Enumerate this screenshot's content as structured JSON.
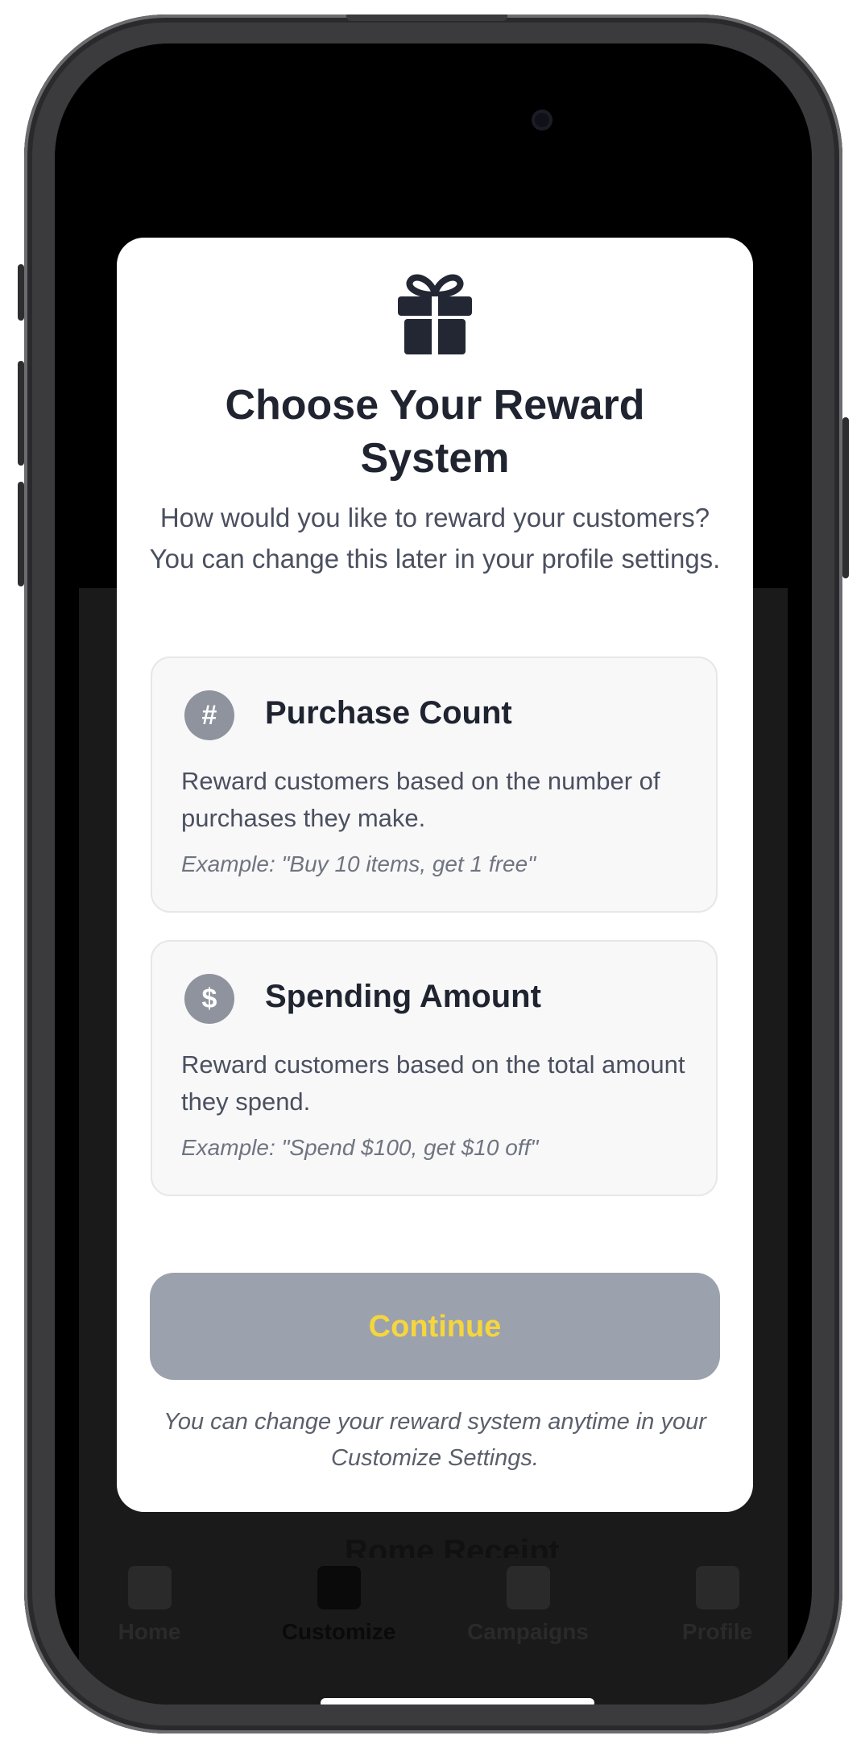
{
  "modal": {
    "icon": "gift-icon",
    "title": "Choose Your Reward System",
    "subtitle": "How would you like to reward your customers? You can change this later in your profile settings.",
    "options": [
      {
        "icon": "hash-icon",
        "glyph": "#",
        "title": "Purchase Count",
        "description": "Reward customers based on the number of purchases they make.",
        "example": "Example: \"Buy 10 items, get 1 free\""
      },
      {
        "icon": "dollar-icon",
        "glyph": "$",
        "title": "Spending Amount",
        "description": "Reward customers based on the total amount they spend.",
        "example": "Example: \"Spend $100, get $10 off\""
      }
    ],
    "continue_label": "Continue",
    "footnote": "You can change your reward system anytime in your Customize Settings."
  },
  "background_app": {
    "partial_title": "Rome Receipt",
    "tabs": [
      {
        "label": "Home",
        "icon": "home-icon"
      },
      {
        "label": "Customize",
        "icon": "brush-icon",
        "active": true
      },
      {
        "label": "Campaigns",
        "icon": "megaphone-icon"
      },
      {
        "label": "Profile",
        "icon": "person-icon"
      }
    ]
  },
  "colors": {
    "accent_text": "#f5d63d",
    "button_disabled": "#9ca2ad",
    "title_text": "#1f2430"
  }
}
